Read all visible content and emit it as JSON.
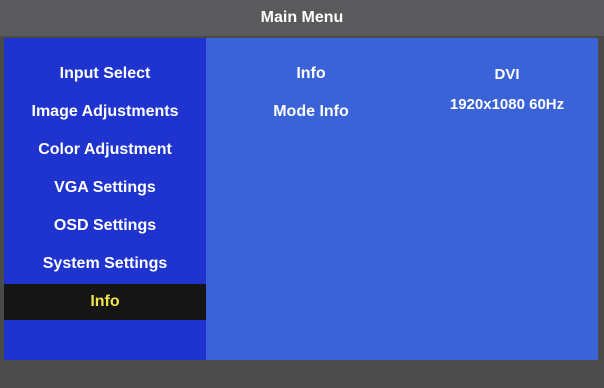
{
  "header": {
    "title": "Main Menu"
  },
  "sidebar": {
    "items": [
      {
        "label": "Input Select"
      },
      {
        "label": "Image Adjustments"
      },
      {
        "label": "Color Adjustment"
      },
      {
        "label": "VGA Settings"
      },
      {
        "label": "OSD Settings"
      },
      {
        "label": "System Settings"
      },
      {
        "label": "Info"
      }
    ],
    "selected": "Info"
  },
  "content": {
    "rows": [
      {
        "label": "Info",
        "value": "DVI"
      },
      {
        "label": "Mode Info",
        "value": "1920x1080 60Hz"
      }
    ]
  },
  "colors": {
    "sidebar_bg": "#1f33cf",
    "content_bg": "#3a63d8",
    "selected_bg": "#151515",
    "selected_text": "#f2e44a"
  }
}
